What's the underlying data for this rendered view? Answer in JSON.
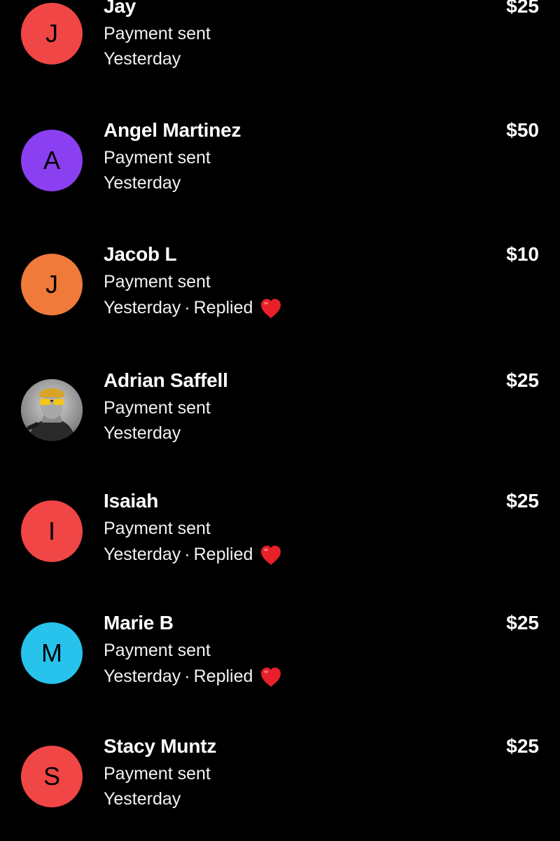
{
  "transactions": [
    {
      "name": "Jay",
      "amount": "$25",
      "status": "Payment sent",
      "time": "Yesterday",
      "replied": "",
      "avatar": {
        "type": "initial",
        "letter": "J",
        "color": "#f04646"
      }
    },
    {
      "name": "Angel Martinez",
      "amount": "$50",
      "status": "Payment sent",
      "time": "Yesterday",
      "replied": "",
      "avatar": {
        "type": "initial",
        "letter": "A",
        "color": "#8a3ff0"
      }
    },
    {
      "name": "Jacob L",
      "amount": "$10",
      "status": "Payment sent",
      "time": "Yesterday",
      "replied": "Replied",
      "avatar": {
        "type": "initial",
        "letter": "J",
        "color": "#f07a3a"
      }
    },
    {
      "name": "Adrian Saffell",
      "amount": "$25",
      "status": "Payment sent",
      "time": "Yesterday",
      "replied": "",
      "avatar": {
        "type": "photo",
        "letter": "",
        "color": "#9a9a9a"
      }
    },
    {
      "name": "Isaiah",
      "amount": "$25",
      "status": "Payment sent",
      "time": "Yesterday",
      "replied": "Replied",
      "avatar": {
        "type": "initial",
        "letter": "I",
        "color": "#f04646"
      }
    },
    {
      "name": "Marie B",
      "amount": "$25",
      "status": "Payment sent",
      "time": "Yesterday",
      "replied": "Replied",
      "avatar": {
        "type": "initial",
        "letter": "M",
        "color": "#27c3ec"
      }
    },
    {
      "name": "Stacy Muntz",
      "amount": "$25",
      "status": "Payment sent",
      "time": "Yesterday",
      "replied": "",
      "avatar": {
        "type": "initial",
        "letter": "S",
        "color": "#f04646"
      }
    }
  ],
  "icons": {
    "reply_reaction": "heart-icon",
    "separator": "·"
  },
  "colors": {
    "background": "#000000",
    "text": "#ffffff",
    "heart": "#e8202a"
  }
}
